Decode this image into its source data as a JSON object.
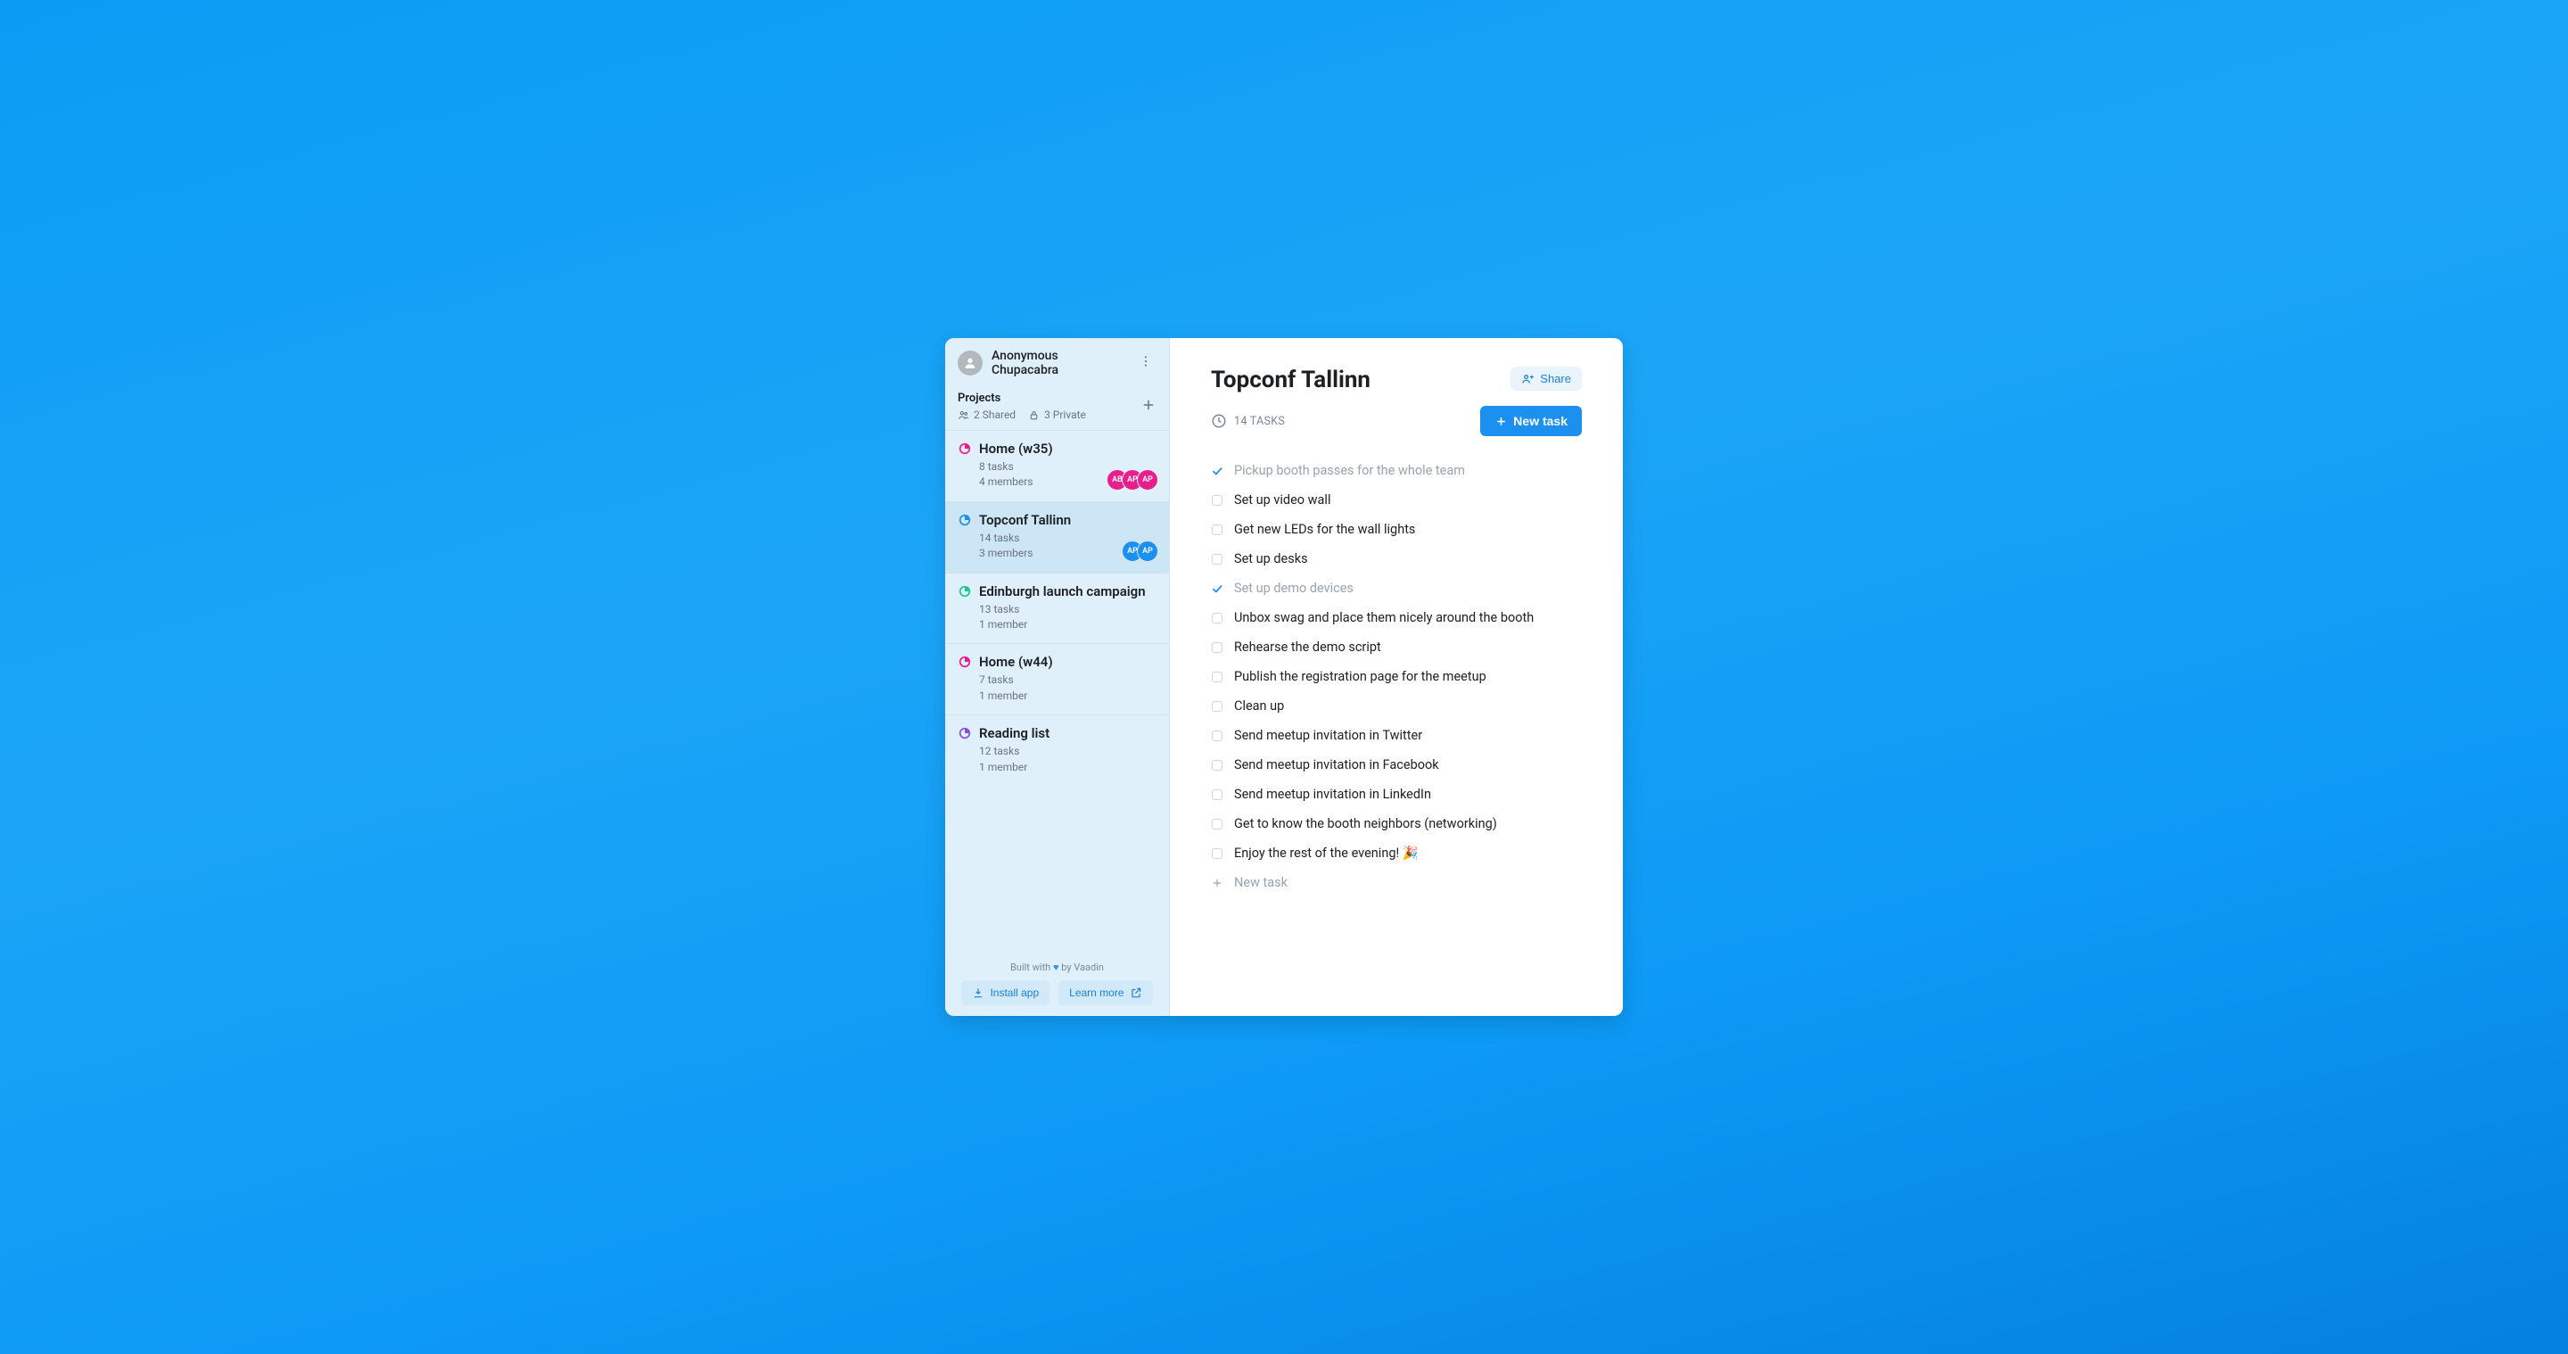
{
  "user": {
    "name": "Anonymous Chupacabra"
  },
  "sidebar": {
    "projects_label": "Projects",
    "shared_count": "2 Shared",
    "private_count": "3 Private",
    "projects": [
      {
        "name": "Home (w35)",
        "tasks": "8 tasks",
        "members": "4 members",
        "icon_color": "#e91e8c",
        "avatars": [
          {
            "label": "AB",
            "bg": "#e91e8c"
          },
          {
            "label": "AP",
            "bg": "#e91e8c"
          },
          {
            "label": "AP",
            "bg": "#e91e8c"
          }
        ],
        "active": false
      },
      {
        "name": "Topconf Tallinn",
        "tasks": "14 tasks",
        "members": "3 members",
        "icon_color": "#1b90f0",
        "avatars": [
          {
            "label": "AP",
            "bg": "#1b90f0"
          },
          {
            "label": "AP",
            "bg": "#1b90f0"
          }
        ],
        "active": true
      },
      {
        "name": "Edinburgh launch campaign",
        "tasks": "13 tasks",
        "members": "1 member",
        "icon_color": "#1cc98a",
        "avatars": [],
        "active": false
      },
      {
        "name": "Home (w44)",
        "tasks": "7 tasks",
        "members": "1 member",
        "icon_color": "#e91e8c",
        "avatars": [],
        "active": false
      },
      {
        "name": "Reading list",
        "tasks": "12 tasks",
        "members": "1 member",
        "icon_color": "#8a4fe0",
        "avatars": [],
        "active": false
      }
    ],
    "built_with_prefix": "Built with ",
    "built_with_suffix": " by Vaadin",
    "install_label": "Install app",
    "learn_label": "Learn more"
  },
  "main": {
    "title": "Topconf Tallinn",
    "share_label": "Share",
    "task_count": "14 TASKS",
    "new_task_button": "New task",
    "new_task_placeholder": "New task",
    "tasks": [
      {
        "text": "Pickup booth passes for the whole team",
        "done": true
      },
      {
        "text": "Set up video wall",
        "done": false
      },
      {
        "text": "Get new LEDs for the wall lights",
        "done": false
      },
      {
        "text": "Set up desks",
        "done": false
      },
      {
        "text": "Set up demo devices",
        "done": true
      },
      {
        "text": "Unbox swag and place them nicely around the booth",
        "done": false
      },
      {
        "text": "Rehearse the demo script",
        "done": false
      },
      {
        "text": "Publish the registration page for the meetup",
        "done": false
      },
      {
        "text": "Clean up",
        "done": false
      },
      {
        "text": "Send meetup invitation in Twitter",
        "done": false
      },
      {
        "text": "Send meetup invitation in Facebook",
        "done": false
      },
      {
        "text": "Send meetup invitation in LinkedIn",
        "done": false
      },
      {
        "text": "Get to know the booth neighbors (networking)",
        "done": false
      },
      {
        "text": "Enjoy the rest of the evening! 🎉",
        "done": false
      }
    ]
  }
}
